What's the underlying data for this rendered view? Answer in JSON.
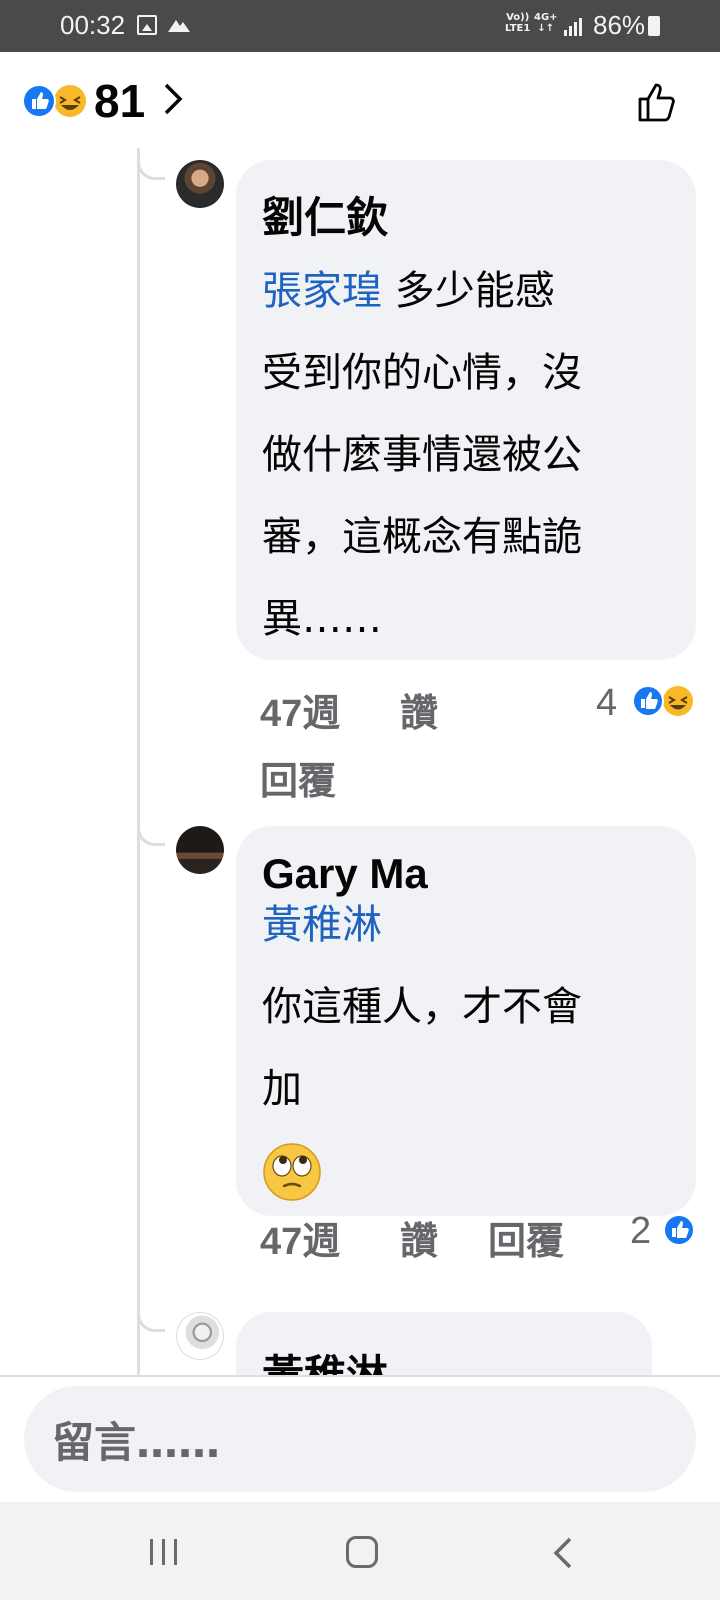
{
  "status_bar": {
    "time": "00:32",
    "volte_line1": "Vo))",
    "volte_line2": "LTE1",
    "network_line1": "4G+",
    "network_line2": "↓↑",
    "battery": "86%"
  },
  "header": {
    "reaction_count": "81",
    "reaction_icons": [
      "like-icon",
      "haha-icon"
    ]
  },
  "comments": [
    {
      "author": "劉仁欽",
      "mention": "張家瑝",
      "lines": [
        "多少能感",
        "受到你的心情，沒",
        "做什麼事情還被公",
        "審，這概念有點詭",
        "異……"
      ],
      "time": "47週",
      "like": "讚",
      "reply": "回覆",
      "reaction_count": "4"
    },
    {
      "author": "Gary Ma",
      "mention": "黃稚淋",
      "lines": [
        "你這種人，才不會",
        "加"
      ],
      "emoji": "face-with-rolling-eyes-icon",
      "time": "47週",
      "like": "讚",
      "reply": "回覆",
      "reaction_count": "2"
    },
    {
      "author": "黃稚淋"
    }
  ],
  "composer": {
    "placeholder": "留言……"
  },
  "colors": {
    "status_bar_bg": "#4a4a4a",
    "bubble_bg": "#f0f2f5",
    "mention": "#1f63c1",
    "meta_text": "#65676b",
    "like_blue": "#1877f2",
    "haha_yellow": "#f7b928"
  }
}
